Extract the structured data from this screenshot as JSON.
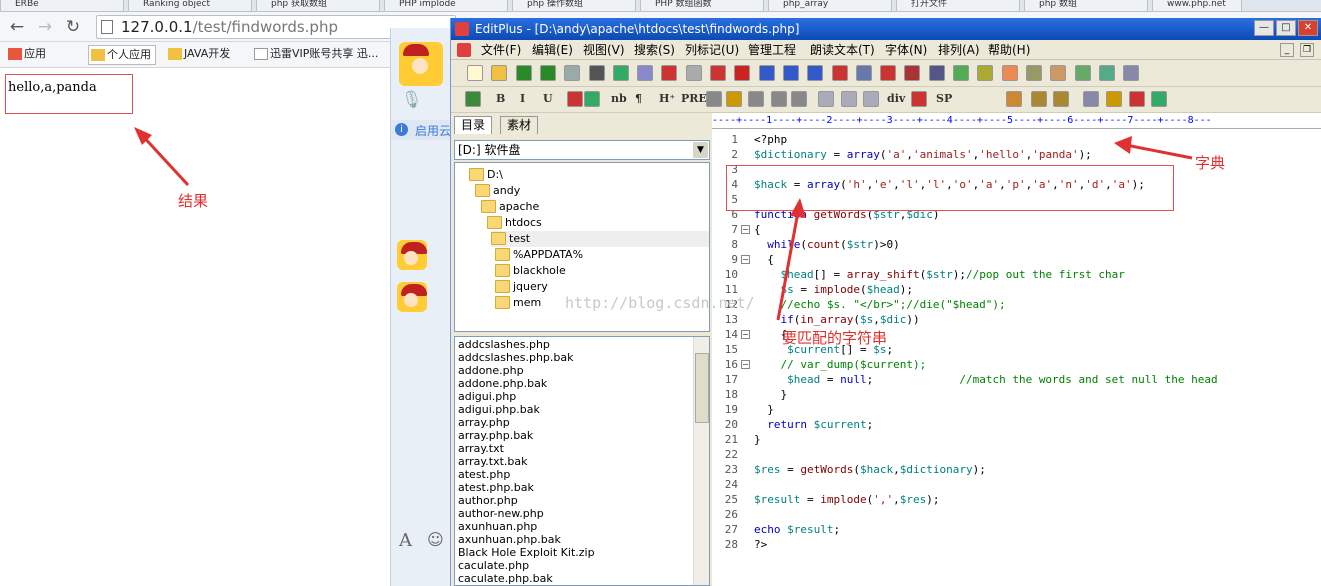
{
  "browser": {
    "tabs": [
      "ERBe",
      "Ranking object",
      "php 获取数组",
      "PHP implode",
      "php 操作数组",
      "PHP 数组函数",
      "php_array",
      "打开文件",
      "php 数组",
      "www.php.net"
    ],
    "url_host": "127.0.0.1",
    "url_path": "/test/findwords.php",
    "bookmarks": [
      "应用",
      "个人应用",
      "JAVA开发",
      "迅雷VIP账号共享 迅..."
    ],
    "page_output": "hello,a,panda"
  },
  "annotations": {
    "result": "结果",
    "dictionary": "字典",
    "match_string": "要匹配的字符串"
  },
  "qq": {
    "notice": "启用云"
  },
  "editplus": {
    "title": "EditPlus - [D:\\andy\\apache\\htdocs\\test\\findwords.php]",
    "menu": [
      "文件(F)",
      "编辑(E)",
      "视图(V)",
      "搜索(S)",
      "列标记(U)",
      "管理工程",
      "朗读文本(T)",
      "字体(N)",
      "排列(A)",
      "帮助(H)"
    ],
    "toolbar2_text": [
      "B",
      "I",
      "U",
      "nb",
      "¶",
      "H⁺",
      "PRE",
      "div",
      "SP"
    ],
    "dir_tabs": [
      "目录",
      "素材"
    ],
    "drive": "[D:] 软件盘",
    "tree": [
      "D:\\",
      "andy",
      "apache",
      "htdocs",
      "test",
      "%APPDATA%",
      "blackhole",
      "jquery",
      "mem"
    ],
    "files": [
      "addcslashes.php",
      "addcslashes.php.bak",
      "addone.php",
      "addone.php.bak",
      "adigui.php",
      "adigui.php.bak",
      "array.php",
      "array.php.bak",
      "array.txt",
      "array.txt.bak",
      "atest.php",
      "atest.php.bak",
      "author.php",
      "author-new.php",
      "axunhuan.php",
      "axunhuan.php.bak",
      "Black Hole Exploit Kit.zip",
      "caculate.php",
      "caculate.php.bak"
    ],
    "ruler": "----+----1----+----2----+----3----+----4----+----5----+----6----+----7----+----8---",
    "watermark": "http://blog.csdn.net/",
    "code": [
      "<?php",
      "$dictionary = array('a','animals','hello','panda');",
      "",
      "$hack = array('h','e','l','l','o','a','p','a','n','d','a');",
      "",
      "function getWords($str,$dic)",
      "{",
      "  while(count($str)>0)",
      "  {",
      "    $head[] = array_shift($str);//pop out the first char",
      "    $s = implode($head);",
      "    //echo $s. \"</br>\";//die(\"$head\");",
      "    if(in_array($s,$dic))",
      "    {",
      "     $current[] = $s;",
      "    // var_dump($current);",
      "     $head = null;             //match the words and set null the head",
      "    }",
      "  }",
      "  return $current;",
      "}",
      "",
      "$res = getWords($hack,$dictionary);",
      "",
      "$result = implode(',',$res);",
      "",
      "echo $result;",
      "?>"
    ]
  }
}
